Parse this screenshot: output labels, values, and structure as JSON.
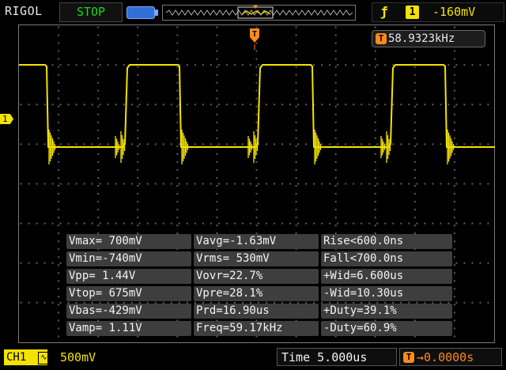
{
  "header": {
    "brand": "RIGOL",
    "run_state": "STOP",
    "trigger": {
      "slope_icon": "rising-edge-icon",
      "source_channel": "1",
      "level": "-160mV"
    }
  },
  "frequency_counter": {
    "icon": "T",
    "value": "58.9323kHz"
  },
  "channel_marker": "1",
  "trigger_position_marker": "T",
  "measurements": {
    "rows": [
      [
        "Vmax= 700mV",
        "Vavg=-1.63mV",
        "Rise<600.0ns"
      ],
      [
        "Vmin=-740mV",
        "Vrms= 530mV",
        "Fall<700.0ns"
      ],
      [
        "Vpp= 1.44V",
        "Vovr=22.7%",
        "+Wid=6.600us"
      ],
      [
        "Vtop= 675mV",
        "Vpre=28.1%",
        "-Wid=10.30us"
      ],
      [
        "Vbas=-429mV",
        "Prd=16.90us",
        "+Duty=39.1%"
      ],
      [
        "Vamp= 1.11V",
        "Freq=59.17kHz",
        "-Duty=60.9%"
      ]
    ]
  },
  "footer": {
    "channel_label": "CH1",
    "coupling_icon": "ac-coupling-icon",
    "coupling_symbol": "∿",
    "volts_per_div": "500mV",
    "timebase": "Time 5.000us",
    "trigger_offset_icon": "T",
    "trigger_offset": "0.0000s"
  },
  "colors": {
    "trace": "#f4e300",
    "trigger": "#ff8a1e",
    "run_state": "#18d818",
    "grid": "#6a6a6a",
    "meas_bg": "#3e3e3e"
  }
}
